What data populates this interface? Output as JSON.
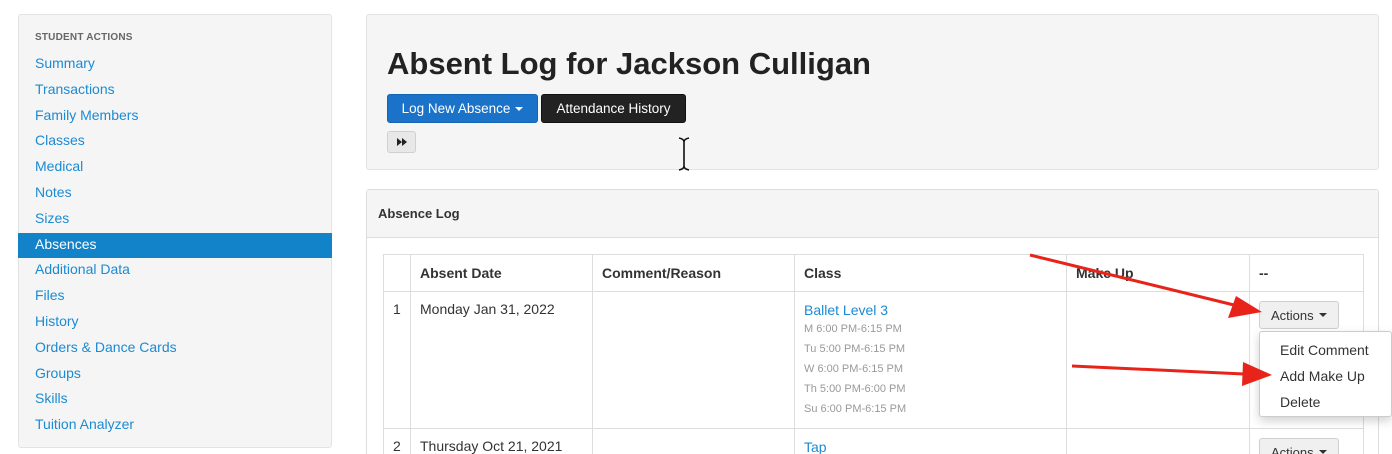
{
  "sidebar": {
    "title": "STUDENT ACTIONS",
    "items": [
      {
        "label": "Summary"
      },
      {
        "label": "Transactions"
      },
      {
        "label": "Family Members"
      },
      {
        "label": "Classes"
      },
      {
        "label": "Medical"
      },
      {
        "label": "Notes"
      },
      {
        "label": "Sizes"
      },
      {
        "label": "Absences",
        "active": true
      },
      {
        "label": "Additional Data"
      },
      {
        "label": "Files"
      },
      {
        "label": "History"
      },
      {
        "label": "Orders & Dance Cards"
      },
      {
        "label": "Groups"
      },
      {
        "label": "Skills"
      },
      {
        "label": "Tuition Analyzer"
      }
    ]
  },
  "header": {
    "title": "Absent Log for Jackson Culligan",
    "log_new_absence_label": "Log New Absence",
    "attendance_history_label": "Attendance History"
  },
  "log": {
    "heading": "Absence Log",
    "columns": [
      "",
      "Absent Date",
      "Comment/Reason",
      "Class",
      "Make Up",
      "--"
    ],
    "rows": [
      {
        "num": "1",
        "date": "Monday Jan 31, 2022",
        "comment": "",
        "class_name": "Ballet Level 3",
        "schedule": [
          "M 6:00 PM-6:15 PM",
          "Tu 5:00 PM-6:15 PM",
          "W 6:00 PM-6:15 PM",
          "Th 5:00 PM-6:00 PM",
          "Su 6:00 PM-6:15 PM"
        ],
        "makeup": "",
        "actions_label": "Actions"
      },
      {
        "num": "2",
        "date": "Thursday Oct 21, 2021",
        "comment": "",
        "class_name": "Tap",
        "schedule": [],
        "makeup": "",
        "actions_label": "Actions"
      }
    ]
  },
  "dropdown": {
    "items": [
      "Edit Comment",
      "Add Make Up",
      "Delete"
    ]
  },
  "colors": {
    "accent": "#1283c9",
    "link": "#1b8bd3",
    "primary_button": "#1a73c8",
    "dark_button": "#222222",
    "annotation_arrow": "#e8241a"
  },
  "icons": {
    "fast_forward": "fast-forward-icon",
    "caret": "caret-down-icon"
  }
}
